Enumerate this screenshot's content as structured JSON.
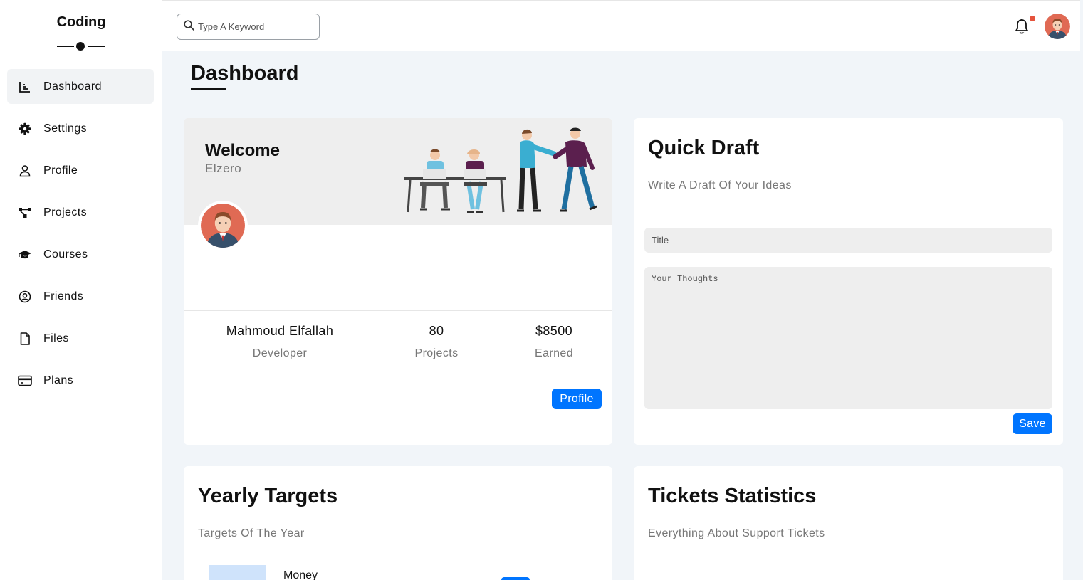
{
  "brand": {
    "name": "Coding"
  },
  "sidebar": {
    "items": [
      {
        "label": "Dashboard",
        "icon": "chart-icon",
        "active": true
      },
      {
        "label": "Settings",
        "icon": "gear-icon"
      },
      {
        "label": "Profile",
        "icon": "user-icon"
      },
      {
        "label": "Projects",
        "icon": "diagram-icon"
      },
      {
        "label": "Courses",
        "icon": "graduation-cap-icon"
      },
      {
        "label": "Friends",
        "icon": "user-circle-icon"
      },
      {
        "label": "Files",
        "icon": "file-icon"
      },
      {
        "label": "Plans",
        "icon": "credit-card-icon"
      }
    ]
  },
  "header": {
    "search_placeholder": "Type A Keyword",
    "notification_dot_color": "#e5533c"
  },
  "page": {
    "title": "Dashboard"
  },
  "welcome": {
    "title": "Welcome",
    "subtitle": "Elzero",
    "stats": [
      {
        "value": "Mahmoud Elfallah",
        "label": "Developer"
      },
      {
        "value": "80",
        "label": "Projects"
      },
      {
        "value": "$8500",
        "label": "Earned"
      }
    ],
    "profile_button": "Profile"
  },
  "draft": {
    "title": "Quick Draft",
    "subtitle": "Write A Draft Of Your Ideas",
    "title_placeholder": "Title",
    "thoughts_placeholder": "Your Thoughts",
    "save_button": "Save"
  },
  "targets": {
    "title": "Yearly Targets",
    "subtitle": "Targets Of The Year",
    "first_label": "Money"
  },
  "tickets": {
    "title": "Tickets Statistics",
    "subtitle": "Everything About Support Tickets"
  },
  "colors": {
    "accent": "#0075ff",
    "background": "#f1f5f9",
    "panel": "#eeeeee"
  }
}
